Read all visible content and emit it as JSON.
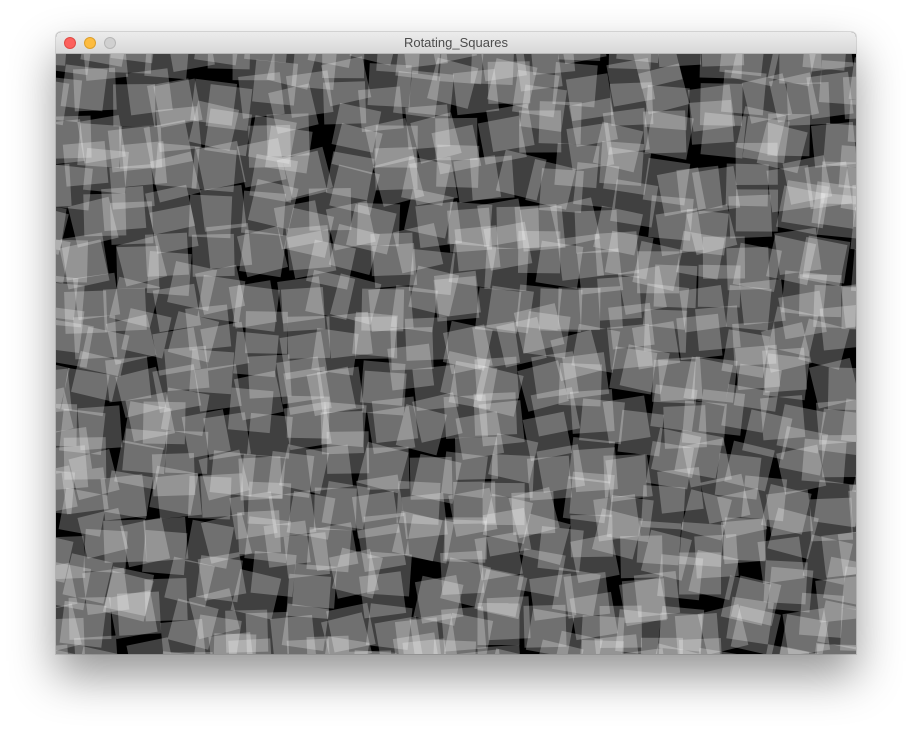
{
  "window": {
    "title": "Rotating_Squares",
    "controls": {
      "close": "close-icon",
      "minimize": "minimize-icon",
      "zoom": "zoom-icon"
    },
    "colors": {
      "titlebar": "#e3e3e3",
      "close": "#fc605c",
      "minimize": "#fdbc40",
      "zoom": "#d0d0d0"
    }
  },
  "sketch": {
    "background": "#000000",
    "square_fill": "#ffffff",
    "square_opacity": 0.25
  }
}
